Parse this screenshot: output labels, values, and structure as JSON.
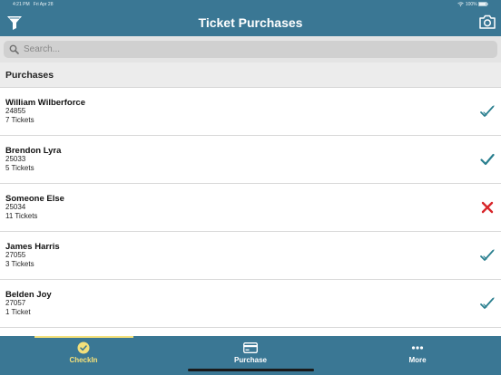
{
  "status_bar": {
    "time": "4:21 PM",
    "date": "Fri Apr 28",
    "battery": "100%"
  },
  "header": {
    "title": "Ticket Purchases",
    "left_icon": "filter-icon",
    "right_icon": "camera-icon",
    "color": "#3a7794"
  },
  "search": {
    "placeholder": "Search..."
  },
  "section": {
    "title": "Purchases"
  },
  "purchases": [
    {
      "name": "William Wilberforce",
      "number": "24855",
      "tickets": "7 Tickets",
      "status": "double-check-icon"
    },
    {
      "name": "Brendon Lyra",
      "number": "25033",
      "tickets": "5 Tickets",
      "status": "check-icon"
    },
    {
      "name": "Someone Else",
      "number": "25034",
      "tickets": "11 Tickets",
      "status": "x-icon"
    },
    {
      "name": "James Harris",
      "number": "27055",
      "tickets": "3 Tickets",
      "status": "double-check-icon"
    },
    {
      "name": "Belden Joy",
      "number": "27057",
      "tickets": "1 Ticket",
      "status": "double-check-icon"
    }
  ],
  "tabs": [
    {
      "label": "CheckIn",
      "icon": "check-circle-icon",
      "active": true
    },
    {
      "label": "Purchase",
      "icon": "card-icon",
      "active": false
    },
    {
      "label": "More",
      "icon": "more-icon",
      "active": false
    }
  ],
  "colors": {
    "accent": "#3a7794",
    "check": "#2a7f8f",
    "error": "#d8262b",
    "active_tab": "#f3e07a"
  }
}
